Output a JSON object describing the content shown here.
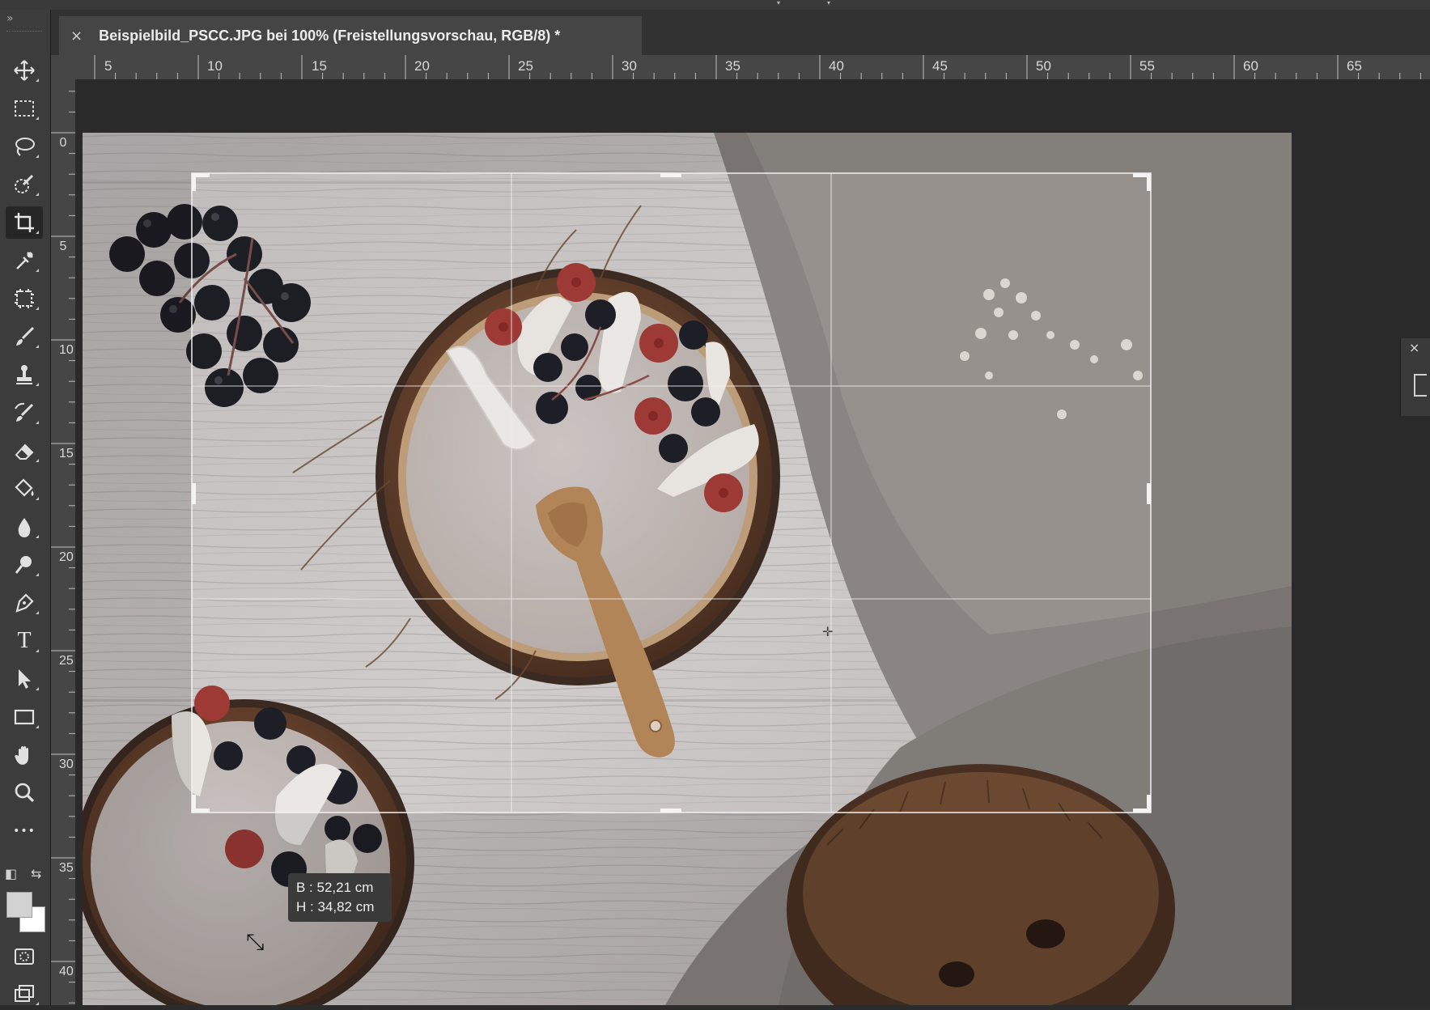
{
  "document": {
    "tab_close": "×",
    "title": "Beispielbild_PSCC.JPG bei 100% (Freistellungsvorschau, RGB/8) *"
  },
  "toolbar": {
    "collapse_glyph": "»",
    "tools": [
      {
        "name": "move-tool",
        "icon": "move-icon"
      },
      {
        "name": "rectangular-marquee-tool",
        "icon": "marquee-icon"
      },
      {
        "name": "lasso-tool",
        "icon": "lasso-icon"
      },
      {
        "name": "quick-selection-tool",
        "icon": "quick-selection-icon"
      },
      {
        "name": "crop-tool",
        "icon": "crop-icon",
        "active": true
      },
      {
        "name": "eyedropper-tool",
        "icon": "eyedropper-icon"
      },
      {
        "name": "frame-tool",
        "icon": "frame-icon"
      },
      {
        "name": "brush-tool",
        "icon": "brush-icon"
      },
      {
        "name": "clone-stamp-tool",
        "icon": "stamp-icon"
      },
      {
        "name": "history-brush-tool",
        "icon": "history-brush-icon"
      },
      {
        "name": "eraser-tool",
        "icon": "eraser-icon"
      },
      {
        "name": "paint-bucket-tool",
        "icon": "bucket-icon"
      },
      {
        "name": "blur-tool",
        "icon": "drop-icon"
      },
      {
        "name": "dodge-tool",
        "icon": "dodge-icon"
      },
      {
        "name": "pen-tool",
        "icon": "pen-icon"
      },
      {
        "name": "type-tool",
        "icon": "type-icon",
        "label": "T"
      },
      {
        "name": "path-selection-tool",
        "icon": "arrow-icon"
      },
      {
        "name": "rectangle-tool",
        "icon": "rectangle-icon"
      },
      {
        "name": "hand-tool",
        "icon": "hand-icon"
      },
      {
        "name": "zoom-tool",
        "icon": "zoom-icon"
      },
      {
        "name": "more-tools",
        "icon": "ellipsis-icon",
        "label": "•••"
      }
    ],
    "foreground_color": "#d2d2d2",
    "background_color": "#ffffff"
  },
  "ruler": {
    "horizontal": [
      "5",
      "10",
      "15",
      "20",
      "25",
      "30",
      "35",
      "40",
      "45",
      "50",
      "55",
      "60",
      "65"
    ],
    "vertical": [
      "0",
      "5",
      "10",
      "15",
      "20",
      "25",
      "30",
      "35",
      "40"
    ]
  },
  "crop": {
    "width_readout": "B : 52,21 cm",
    "height_readout": "H : 34,82 cm"
  },
  "panel": {
    "close_glyph": "×"
  }
}
